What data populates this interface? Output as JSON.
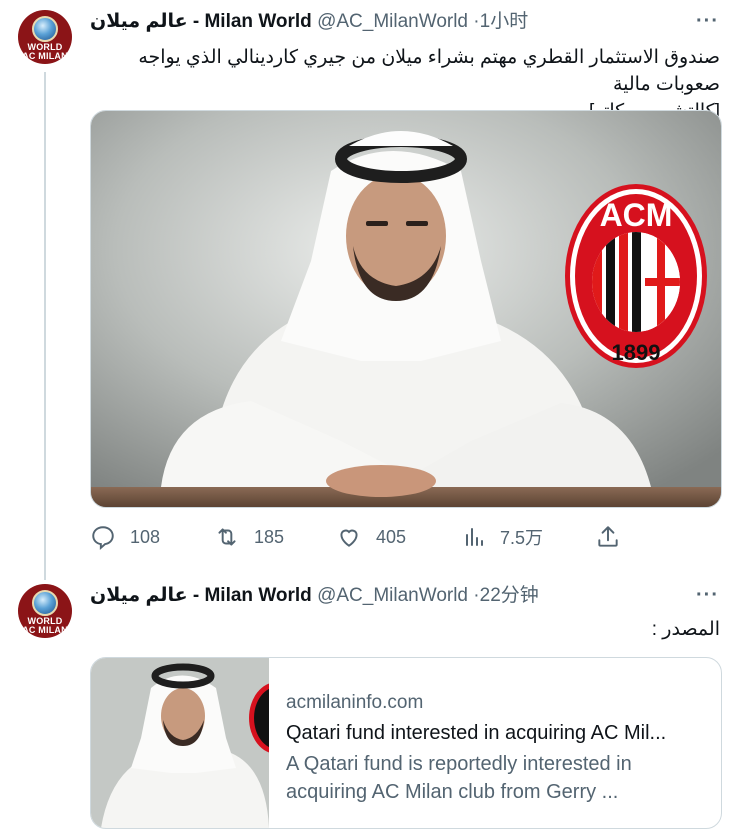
{
  "tweets": [
    {
      "avatar_text": "WORLD AC MILAN",
      "display_name": "عالم ميلان - Milan World",
      "handle": "@AC_MilanWorld",
      "time": "1小时",
      "text_line1": "صندوق الاستثمار القطري مهتم بشراء ميلان من جيري كاردينالي الذي يواجه صعوبات مالية",
      "text_line2": "[كالتشيو ميركاتو]",
      "media_logo_text": "ACM",
      "media_logo_year": "1899",
      "stats": {
        "replies": "108",
        "retweets": "185",
        "likes": "405",
        "views": "7.5万"
      }
    },
    {
      "avatar_text": "WORLD AC MILAN",
      "display_name": "عالم ميلان - Milan World",
      "handle": "@AC_MilanWorld",
      "time": "22分钟",
      "text": "المصدر :",
      "card": {
        "domain": "acmilaninfo.com",
        "title": "Qatari fund interested in acquiring AC Mil...",
        "description_line1": "A Qatari fund is reportedly interested in",
        "description_line2": "acquiring AC Milan club from Gerry ..."
      }
    }
  ],
  "icons": [
    "reply-icon",
    "retweet-icon",
    "like-icon",
    "views-icon",
    "share-icon",
    "more-icon"
  ],
  "colors": {
    "text": "#0f1419",
    "secondary": "#536471",
    "border": "#cfd9de",
    "milan_red": "#d6111e"
  }
}
